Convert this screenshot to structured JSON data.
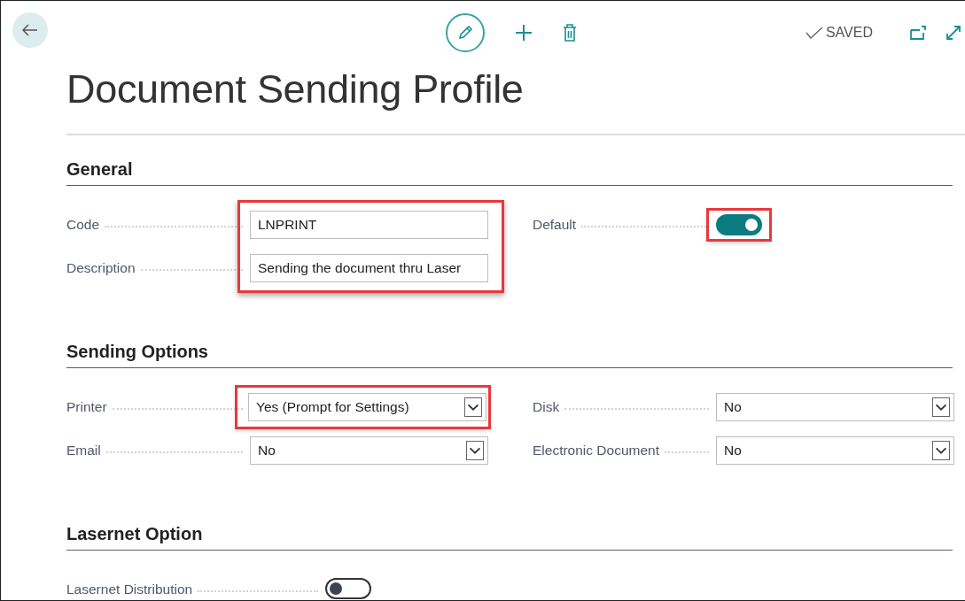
{
  "toolbar": {
    "status": "SAVED"
  },
  "title": "Document Sending Profile",
  "sections": [
    {
      "heading": "General",
      "columns": [
        [
          {
            "label": "Code",
            "kind": "text",
            "value": "LNPRINT",
            "highlighted": true
          },
          {
            "label": "Description",
            "kind": "text",
            "value": "Sending the document thru Laser",
            "highlighted": true
          }
        ],
        [
          {
            "label": "Default",
            "kind": "toggle",
            "on": true,
            "highlighted": true
          }
        ]
      ]
    },
    {
      "heading": "Sending Options",
      "columns": [
        [
          {
            "label": "Printer",
            "kind": "select",
            "value": "Yes (Prompt for Settings)",
            "highlighted": true
          },
          {
            "label": "Email",
            "kind": "select",
            "value": "No",
            "highlighted": false
          }
        ],
        [
          {
            "label": "Disk",
            "kind": "select",
            "value": "No",
            "highlighted": false
          },
          {
            "label": "Electronic Document",
            "kind": "select",
            "value": "No",
            "highlighted": false
          }
        ]
      ]
    },
    {
      "heading": "Lasernet Option",
      "columns": [
        [
          {
            "label": "Lasernet Distribution",
            "kind": "toggle",
            "on": false,
            "highlighted": false
          }
        ]
      ]
    }
  ]
}
